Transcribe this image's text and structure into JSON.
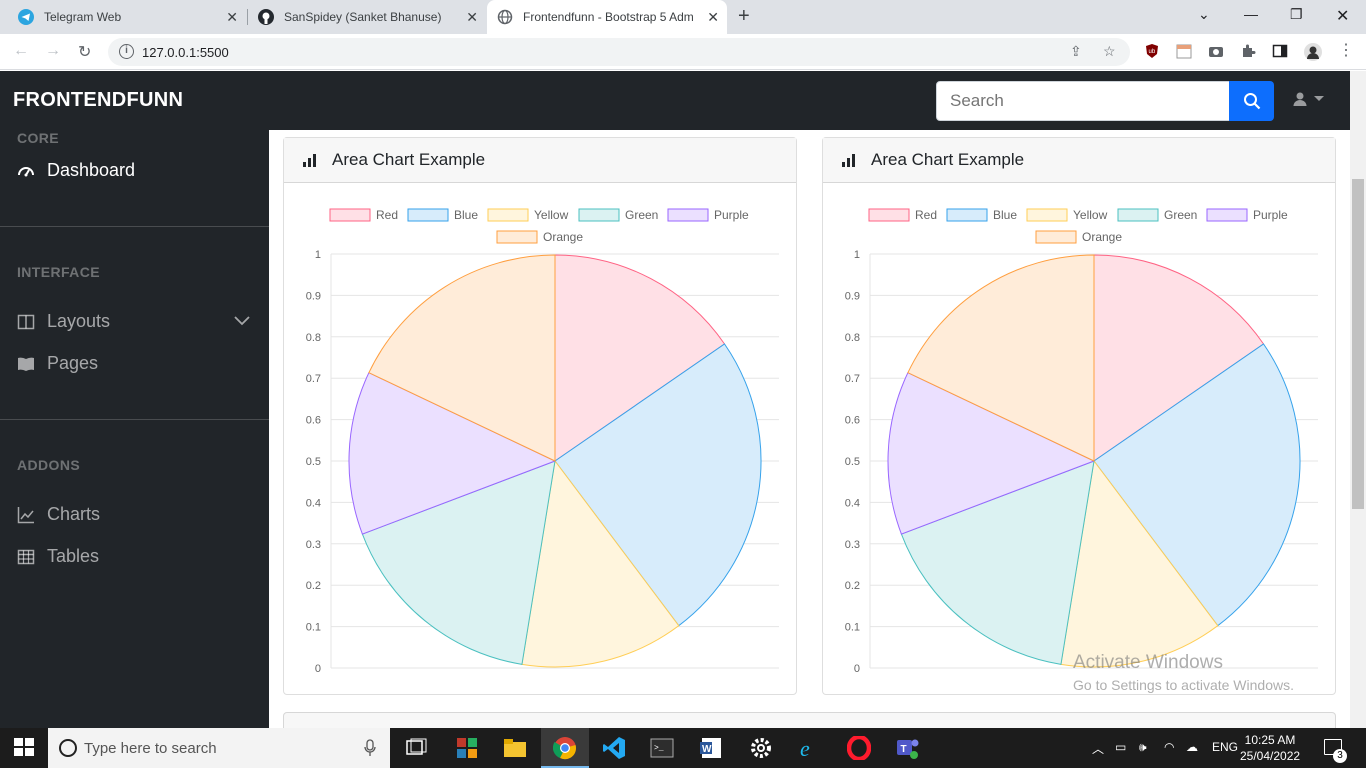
{
  "browser": {
    "tabs": [
      {
        "title": "Telegram Web",
        "active": false
      },
      {
        "title": "SanSpidey (Sanket Bhanuse)",
        "active": false
      },
      {
        "title": "Frontendfunn - Bootstrap 5 Adm",
        "active": true
      }
    ],
    "url": "127.0.0.1:5500"
  },
  "app": {
    "brand": "FRONTENDFUNN",
    "search_placeholder": "Search"
  },
  "sidebar": {
    "sections": [
      {
        "heading": "CORE",
        "items": [
          {
            "label": "Dashboard",
            "icon": "tachometer-icon"
          }
        ]
      },
      {
        "heading": "INTERFACE",
        "items": [
          {
            "label": "Layouts",
            "icon": "columns-icon"
          },
          {
            "label": "Pages",
            "icon": "book-open-icon"
          }
        ]
      },
      {
        "heading": "ADDONS",
        "items": [
          {
            "label": "Charts",
            "icon": "chart-area-icon"
          },
          {
            "label": "Tables",
            "icon": "table-icon"
          }
        ]
      }
    ]
  },
  "cards": [
    {
      "title": "Area Chart Example"
    },
    {
      "title": "Area Chart Example"
    }
  ],
  "chart_data": [
    {
      "type": "pie",
      "labels": [
        "Red",
        "Blue",
        "Yellow",
        "Green",
        "Purple",
        "Orange"
      ],
      "values": [
        12,
        19,
        10,
        13,
        10,
        14
      ],
      "yticks": [
        "0",
        "0.1",
        "0.2",
        "0.3",
        "0.4",
        "0.5",
        "0.6",
        "0.7",
        "0.8",
        "0.9",
        "1"
      ],
      "colors": [
        "#ff6384",
        "#36a2eb",
        "#ffce56",
        "#4bc0c0",
        "#9966ff",
        "#ff9f40"
      ],
      "fill_colors": [
        "#ffe0e6",
        "#d7ecfb",
        "#fff5dd",
        "#dbf2f2",
        "#ebe0ff",
        "#ffecd9"
      ],
      "legend": "top",
      "grid": true
    },
    {
      "type": "pie",
      "labels": [
        "Red",
        "Blue",
        "Yellow",
        "Green",
        "Purple",
        "Orange"
      ],
      "values": [
        12,
        19,
        10,
        13,
        10,
        14
      ],
      "yticks": [
        "0",
        "0.1",
        "0.2",
        "0.3",
        "0.4",
        "0.5",
        "0.6",
        "0.7",
        "0.8",
        "0.9",
        "1"
      ],
      "colors": [
        "#ff6384",
        "#36a2eb",
        "#ffce56",
        "#4bc0c0",
        "#9966ff",
        "#ff9f40"
      ],
      "fill_colors": [
        "#ffe0e6",
        "#d7ecfb",
        "#fff5dd",
        "#dbf2f2",
        "#ebe0ff",
        "#ffecd9"
      ],
      "legend": "top",
      "grid": true
    }
  ],
  "overlay": {
    "activate_title": "Activate Windows",
    "activate_sub": "Go to Settings to activate Windows."
  },
  "taskbar": {
    "search_placeholder": "Type here to search",
    "language": "ENG",
    "time": "10:25 AM",
    "date": "25/04/2022",
    "notification_count": "3"
  }
}
